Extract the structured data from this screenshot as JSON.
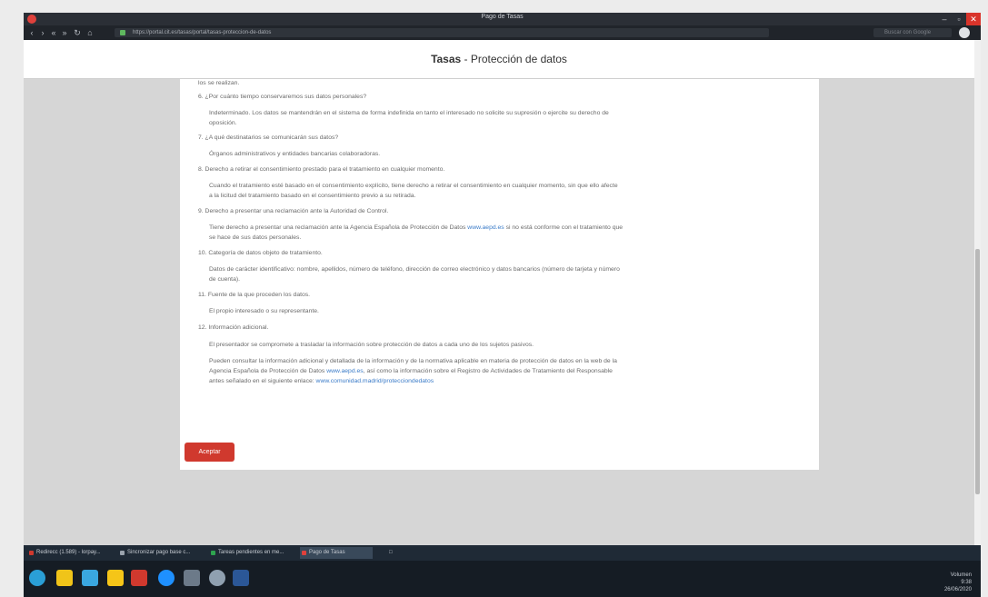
{
  "browser": {
    "window_title": "Pago de Tasas",
    "url": "https://portal.cit.es/tasas/portal/tasas-proteccion-de-datos",
    "search_placeholder": "Buscar con Google",
    "colors": {
      "accent": "#d0392e",
      "link": "#3a7bc8"
    }
  },
  "page": {
    "title_bold": "Tasas",
    "title_rest": " - Protección de datos"
  },
  "content": {
    "lines": [
      "los se realizan.",
      "6. ¿Por cuánto tiempo conservaremos sus datos personales?",
      "Indeterminado. Los datos se mantendrán en el sistema de forma indefinida en tanto el interesado no solicite su supresión o ejercite su derecho de",
      "oposición.",
      "7. ¿A qué destinatarios se comunicarán sus datos?",
      "Órganos administrativos y entidades bancarias colaboradoras.",
      "8. Derecho a retirar el consentimiento prestado para el tratamiento en cualquier momento.",
      "Cuando el tratamiento esté basado en el consentimiento explícito, tiene derecho a retirar el consentimiento en cualquier momento, sin que ello afecte",
      "a la licitud del tratamiento basado en el consentimiento previo a su retirada.",
      "9. Derecho a presentar una reclamación ante la Autoridad de Control.",
      "Tiene derecho a presentar una reclamación ante la Agencia Española de Protección de Datos",
      "www.aepd.es",
      "si no está conforme con el tratamiento que",
      "se hace de sus datos personales.",
      "10. Categoría de datos objeto de tratamiento.",
      "Datos de carácter identificativo: nombre, apellidos, número de teléfono, dirección de correo electrónico y datos bancarios (número de tarjeta y número",
      "de cuenta).",
      "11. Fuente de la que proceden los datos.",
      "El propio interesado o su representante.",
      "12. Información adicional.",
      "El presentador se compromete a trasladar la información sobre protección de datos a cada uno de los sujetos pasivos.",
      "Pueden consultar la información adicional y detallada de la información y de la normativa aplicable en materia de protección de datos en la web de la",
      "Agencia Española de Protección de Datos",
      "www.aepd.es",
      ", así como la información sobre el Registro de Actividades de Tratamiento del Responsable",
      "antes señalado en el siguiente enlace:",
      "www.comunidad.madrid/protecciondedatos"
    ],
    "accept_label": "Aceptar"
  },
  "taskbar": {
    "tasks": [
      {
        "label": "Redirecc (1.589) - lorpay..."
      },
      {
        "label": "Sincronizar pago base c..."
      },
      {
        "label": "Tareas pendientes en me..."
      },
      {
        "label": "Pago de Tasas"
      }
    ],
    "tray_volume": "Volumen",
    "clock_time": "9:38",
    "clock_date": "26/06/2020"
  }
}
